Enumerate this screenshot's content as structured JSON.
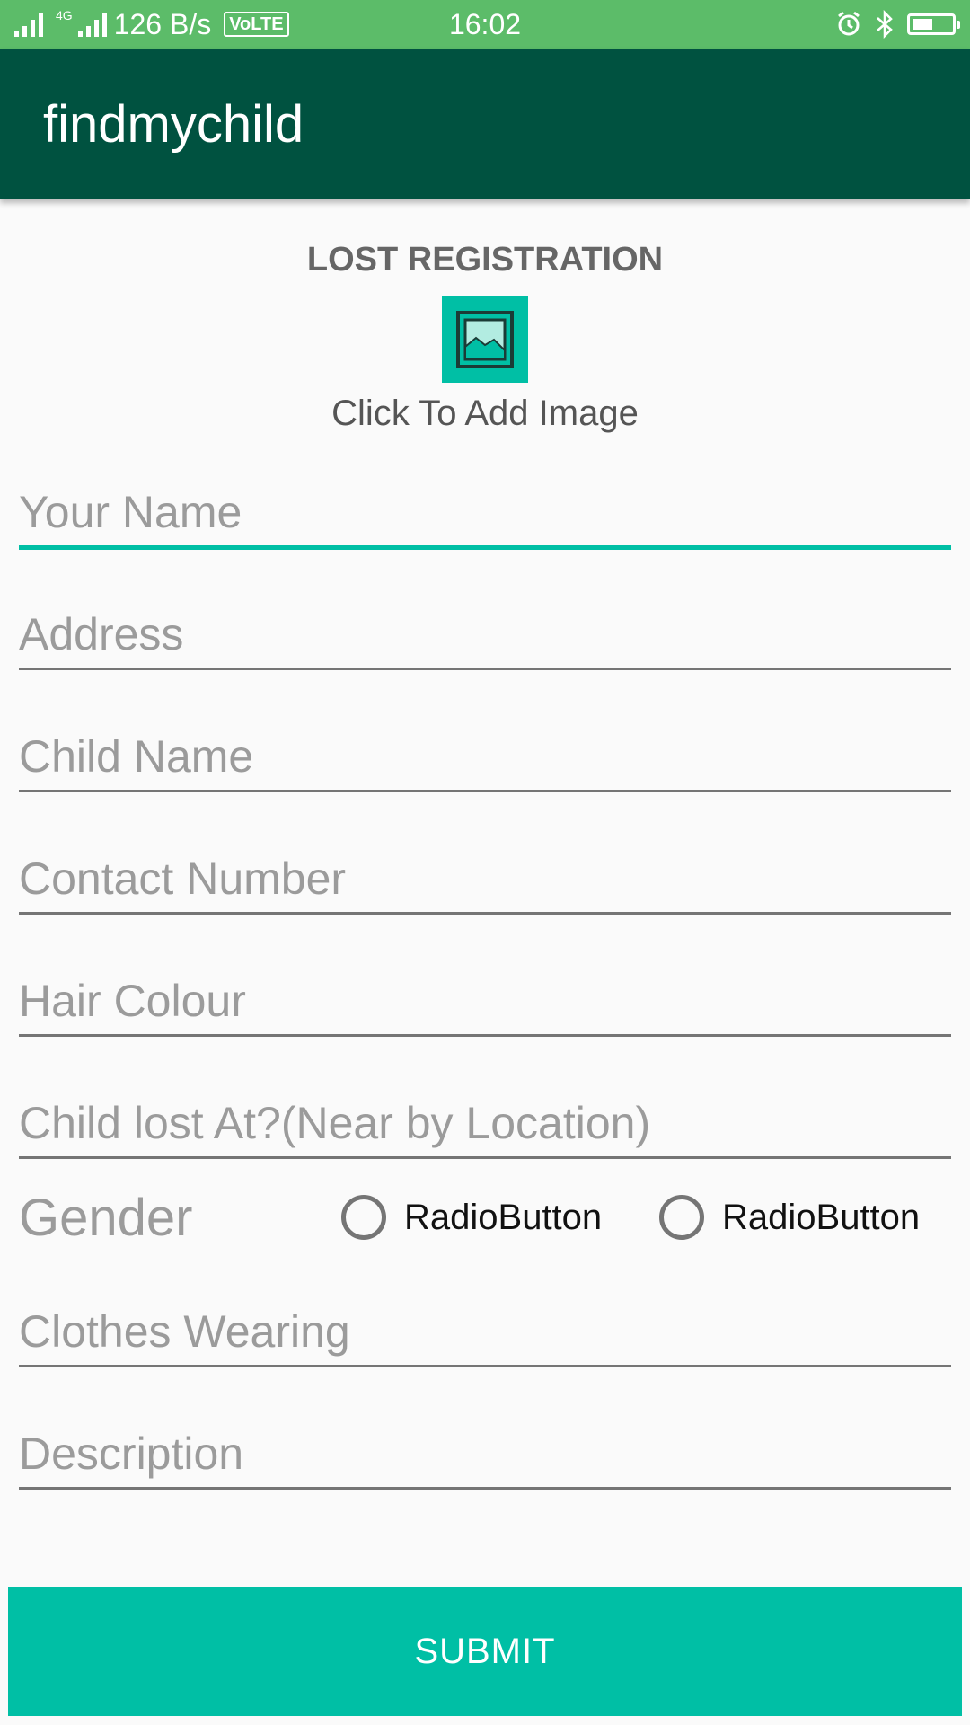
{
  "status_bar": {
    "network_type": "4G",
    "data_speed": "126 B/s",
    "volte": "VoLTE",
    "time": "16:02",
    "icons": [
      "signal-icon",
      "alarm-icon",
      "bluetooth-icon",
      "battery-icon"
    ],
    "battery_level": 0.45
  },
  "app_bar": {
    "title": "findmychild"
  },
  "form": {
    "heading": "LOST REGISTRATION",
    "image_caption": "Click To Add Image",
    "image_icon": "image-icon",
    "fields": {
      "your_name": {
        "placeholder": "Your Name",
        "value": ""
      },
      "address": {
        "placeholder": "Address",
        "value": ""
      },
      "child_name": {
        "placeholder": "Child Name",
        "value": ""
      },
      "contact_number": {
        "placeholder": "Contact Number",
        "value": ""
      },
      "hair_colour": {
        "placeholder": "Hair Colour",
        "value": ""
      },
      "lost_at": {
        "placeholder": "Child lost At?(Near by Location)",
        "value": ""
      },
      "clothes": {
        "placeholder": "Clothes Wearing",
        "value": ""
      },
      "description": {
        "placeholder": "Description",
        "value": ""
      }
    },
    "gender": {
      "label": "Gender",
      "options": [
        "RadioButton",
        "RadioButton"
      ]
    },
    "submit_label": "SUBMIT"
  },
  "colors": {
    "status_bar": "#5cbc69",
    "app_bar": "#005240",
    "accent": "#00bfa5",
    "background": "#fafafa"
  }
}
